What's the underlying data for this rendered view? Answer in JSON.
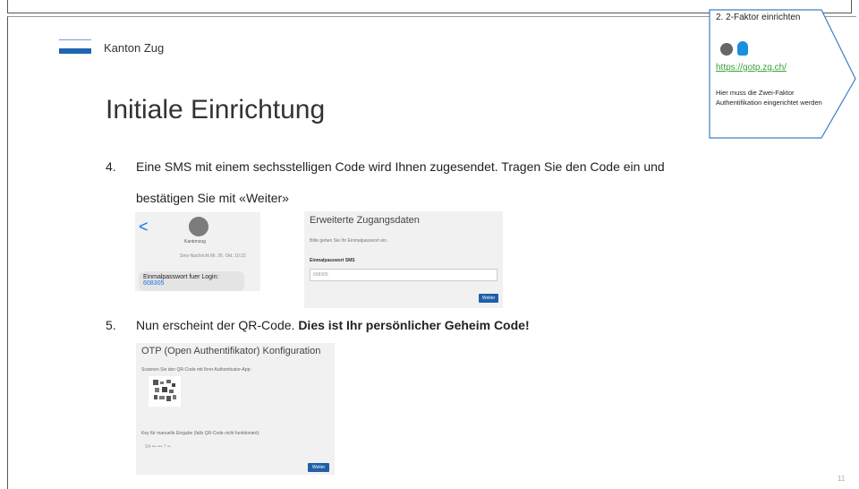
{
  "header": {
    "brand": "Kanton Zug"
  },
  "title": "Initiale Einrichtung",
  "callout": {
    "title": "2. 2-Faktor einrichten",
    "link": "https://gotp.zg.ch/",
    "note": "Hier muss die Zwei-Faktor Authentifikation eingerichtet werden"
  },
  "steps": [
    {
      "number": "4.",
      "text": "Eine SMS mit einem sechsstelligen Code wird Ihnen zugesendet. Tragen Sie den Code ein und",
      "text2": "bestätigen Sie mit «Weiter»"
    },
    {
      "number": "5.",
      "text": "Nun erscheint der QR-Code.",
      "bold": "Dies ist Ihr persönlicher Geheim Code!"
    }
  ],
  "phone": {
    "back": "<",
    "sender": "Kantonzug",
    "date": "Sms-Nachricht Mi. 26. Okt. 10:22",
    "message": "Einmalpasswort fuer Login:",
    "code": "608305"
  },
  "zug_form": {
    "title": "Erweiterte Zugangsdaten",
    "subtitle": "Bitte geben Sie Ihr Einmalpasswort ein.",
    "label": "Einmalpasswort SMS",
    "value": "608305",
    "button": "Weiter"
  },
  "otp_form": {
    "title": "OTP (Open Authentifikator) Konfiguration",
    "instruction": "Scannen Sie den QR-Code mit Ihrer Authenticator-App:",
    "manual": "Key für manuelle Eingabe (falls QR-Code nicht funktioniert):",
    "key": "S4 ••• ••• 7 ••",
    "button": "Weiter"
  },
  "page_number": "11",
  "colors": {
    "brand_blue": "#1f66b0",
    "link_green": "#3aa03a",
    "button_blue": "#1f5fa8"
  }
}
